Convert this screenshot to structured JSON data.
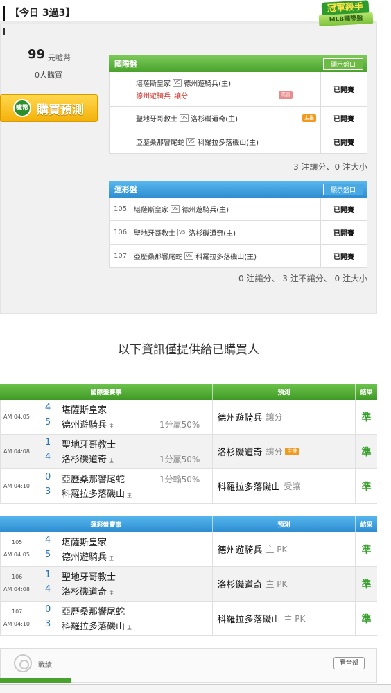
{
  "header": {
    "title": "【今日 3過3】",
    "badge_title": "冠軍殺手",
    "badge_sub": "MLB國際盤"
  },
  "pricing": {
    "amount": "99",
    "unit": "元噓幣",
    "buyers": "0人購買",
    "buy_button": "購買預測",
    "coin_label": "噓幣"
  },
  "intl_market": {
    "title": "國際盤",
    "show_button": "顯示盤口",
    "rows": [
      {
        "away": "堪薩斯皇家",
        "home": "德州遊騎兵(主)",
        "pick": "德州遊騎兵",
        "pick_type": "讓分",
        "tag": "高賣",
        "status": "已開賽"
      },
      {
        "away": "聖地牙哥教士",
        "home": "洛杉磯道奇(主)",
        "tag": "主推",
        "status": "已開賽"
      },
      {
        "away": "亞歷桑那響尾蛇",
        "home": "科羅拉多落磯山(主)",
        "status": "已開賽"
      }
    ],
    "summary": "3 注讓分、0 注大小"
  },
  "lottery_market": {
    "title": "運彩盤",
    "show_button": "顯示盤口",
    "rows": [
      {
        "no": "105",
        "away": "堪薩斯皇家",
        "home": "德州遊騎兵(主)",
        "status": "已開賽"
      },
      {
        "no": "106",
        "away": "聖地牙哥教士",
        "home": "洛杉磯道奇(主)",
        "status": "已開賽"
      },
      {
        "no": "107",
        "away": "亞歷桑那響尾蛇",
        "home": "科羅拉多落磯山(主)",
        "status": "已開賽"
      }
    ],
    "summary": "0 注讓分、 3 注不讓分、 0 注大小"
  },
  "notice": "以下資訊僅提供給已購買人",
  "intl_results": {
    "headers": [
      "國際盤賽事",
      "預測",
      "結果"
    ],
    "home_mark": "主",
    "rows": [
      {
        "time": "AM 04:05",
        "away_score": "4",
        "away": "堪薩斯皇家",
        "home_score": "5",
        "home": "德州遊騎兵",
        "line": "1分贏50%",
        "pick": "德州遊騎兵",
        "pick_type": "讓分",
        "tag": "",
        "result": "準"
      },
      {
        "time": "AM 04:08",
        "away_score": "1",
        "away": "聖地牙哥教士",
        "home_score": "4",
        "home": "洛杉磯道奇",
        "line": "1分贏50%",
        "pick": "洛杉磯道奇",
        "pick_type": "讓分",
        "tag": "主推",
        "result": "準"
      },
      {
        "time": "AM 04:10",
        "away_score": "0",
        "away": "亞歷桑那響尾蛇",
        "home_score": "3",
        "home": "科羅拉多落磯山",
        "line": "1分輸50%",
        "pick": "科羅拉多落磯山",
        "pick_type": "受讓",
        "tag": "",
        "result": "準"
      }
    ]
  },
  "lottery_results": {
    "headers": [
      "運彩盤賽事",
      "預測",
      "結果"
    ],
    "home_mark": "主",
    "rows": [
      {
        "no": "105",
        "time": "AM 04:05",
        "away_score": "4",
        "away": "堪薩斯皇家",
        "home_score": "5",
        "home": "德州遊騎兵",
        "pick": "德州遊騎兵",
        "pick_type": "主 PK",
        "result": "準"
      },
      {
        "no": "106",
        "time": "AM 04:08",
        "away_score": "1",
        "away": "聖地牙哥教士",
        "home_score": "4",
        "home": "洛杉磯道奇",
        "pick": "洛杉磯道奇",
        "pick_type": "主 PK",
        "result": "準"
      },
      {
        "no": "107",
        "time": "AM 04:10",
        "away_score": "0",
        "away": "亞歷桑那響尾蛇",
        "home_score": "3",
        "home": "科羅拉多落磯山",
        "pick": "科羅拉多落磯山",
        "pick_type": "主 PK",
        "result": "準"
      }
    ]
  },
  "record": {
    "label": "戰績",
    "see_all": "看全部"
  },
  "colors": {
    "green": "#48a22c",
    "blue": "#2e8ed1",
    "accent": "#f3b10b",
    "win": "#3aa12f",
    "score": "#2a73b8",
    "pick_red": "#d0322a"
  },
  "icons": [
    "target-icon",
    "coin-icon"
  ]
}
